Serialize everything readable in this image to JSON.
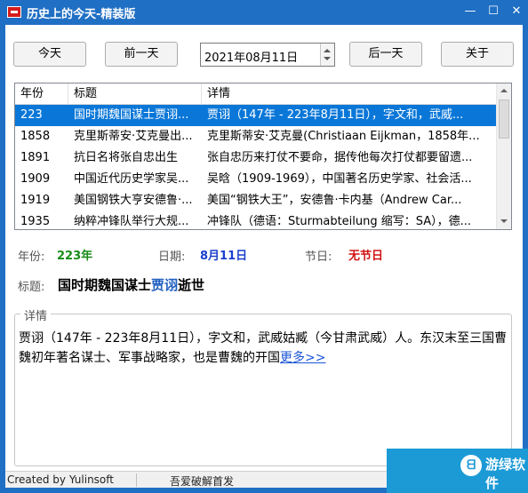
{
  "window": {
    "title": "历史上的今天-精装版",
    "min_glyph": "—",
    "max_glyph": "☐",
    "close_glyph": "✕"
  },
  "toolbar": {
    "today_label": "今天",
    "prev_label": "前一天",
    "date_value": "2021年08月11日",
    "next_label": "后一天",
    "about_label": "关于"
  },
  "table": {
    "columns": [
      "年份",
      "标题",
      "详情"
    ],
    "rows": [
      [
        "223",
        "国时期魏国谋士贾诩...",
        "贾诩（147年 - 223年8月11日），字文和，武威..."
      ],
      [
        "1858",
        "克里斯蒂安·艾克曼出...",
        "克里斯蒂安·艾克曼(Christiaan Eijkman，1858年..."
      ],
      [
        "1891",
        "抗日名将张自忠出生",
        "张自忠历来打仗不要命，据传他每次打仗都要留遗..."
      ],
      [
        "1909",
        "中国近代历史学家吴...",
        "吴晗（1909-1969），中国著名历史学家、社会活..."
      ],
      [
        "1919",
        "美国钢铁大亨安德鲁·...",
        "美国“钢铁大王”，安德鲁·卡内基（Andrew Car..."
      ],
      [
        "1935",
        "纳粹冲锋队举行大规...",
        "冲锋队（德语：Sturmabteilung 缩写：SA），德..."
      ]
    ],
    "selected_index": 0
  },
  "info": {
    "year_label": "年份:",
    "year_value": "223年",
    "date_label": "日期:",
    "date_value": "8月11日",
    "holiday_label": "节日:",
    "holiday_value": "无节日"
  },
  "title_row": {
    "label": "标题:",
    "prefix": "国时期魏国谋士",
    "highlight": "贾诩",
    "suffix": "逝世"
  },
  "detail": {
    "legend": "详情",
    "text": "贾诩（147年 - 223年8月11日），字文和，武威姑臧（今甘肃武威）人。东汉末至三国曹魏初年著名谋士、军事战略家，也是曹魏的开国",
    "more_link": "更多>>"
  },
  "status": {
    "left": "Created by Yulinsoft",
    "mid": "吾爱破解首发"
  },
  "watermark": {
    "badge": "ᗺ",
    "text": "游绿软件"
  },
  "colors": {
    "titlebar": "#1f6fc4",
    "selection": "#0a77d8",
    "year": "#1a8c1a",
    "date": "#1a3fcc",
    "holiday": "#d01515",
    "link": "#1a54d6"
  }
}
